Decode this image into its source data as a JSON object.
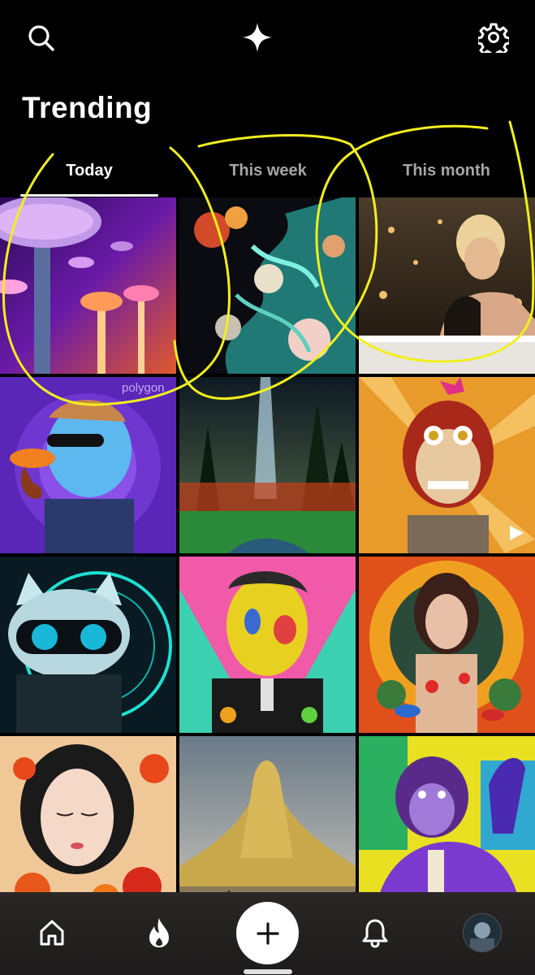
{
  "header": {
    "search_icon": "search-icon",
    "center_icon": "sparkle-icon",
    "settings_icon": "gear-icon"
  },
  "page": {
    "title": "Trending"
  },
  "tabs": [
    {
      "label": "Today",
      "active": true
    },
    {
      "label": "This week",
      "active": false
    },
    {
      "label": "This month",
      "active": false
    }
  ],
  "grid": {
    "tiles": [
      {
        "subject": "neon mushroom forest"
      },
      {
        "subject": "swirling fantasy clouds"
      },
      {
        "subject": "woman in golden bath"
      },
      {
        "subject": "cartoon platypus with pipe",
        "overlay_text": "polygon"
      },
      {
        "subject": "forest with light beam"
      },
      {
        "subject": "cartoon ape with gold eyes",
        "video": true
      },
      {
        "subject": "cat with glasses in neon light"
      },
      {
        "subject": "pop-art portrait of leader"
      },
      {
        "subject": "woman with flowers and birds"
      },
      {
        "subject": "woman with red flowers"
      },
      {
        "subject": "golden monument in sand"
      },
      {
        "subject": "ape in purple suit"
      }
    ]
  },
  "bottom_nav": {
    "items": [
      {
        "icon": "home-icon"
      },
      {
        "icon": "flame-icon"
      },
      {
        "icon": "plus-icon"
      },
      {
        "icon": "bell-icon"
      },
      {
        "icon": "avatar"
      }
    ]
  },
  "colors": {
    "background": "#000000",
    "active_tab": "#ffffff",
    "inactive_tab": "#a6a6a6",
    "annotation": "#f2ef1f",
    "nav_bg": "#221f1f"
  }
}
